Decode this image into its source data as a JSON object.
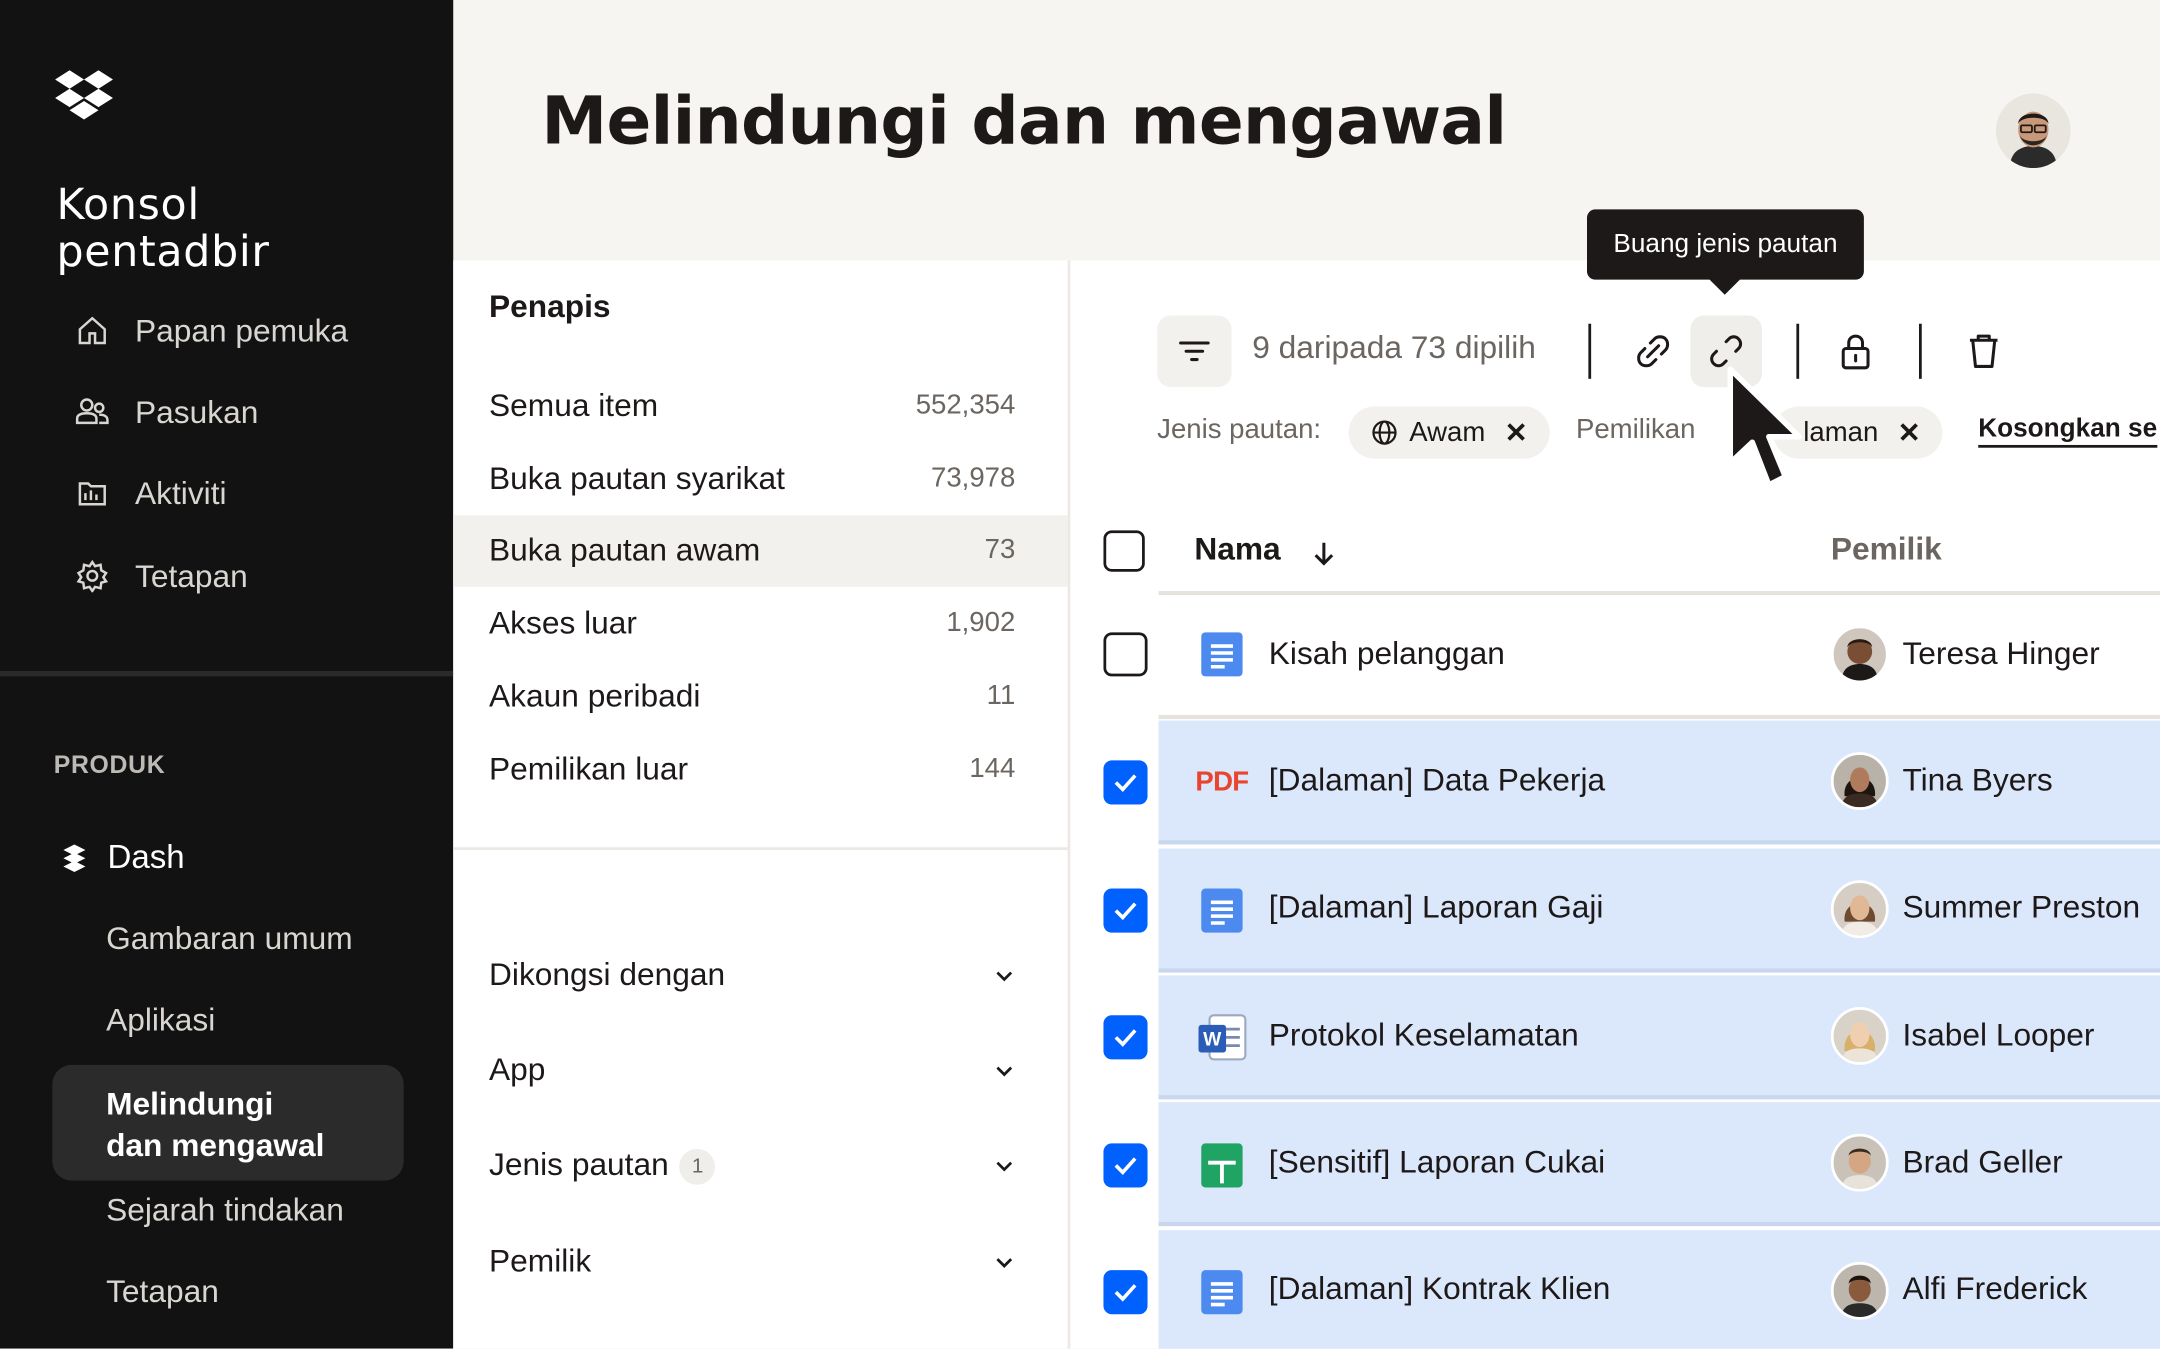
{
  "sidebar": {
    "console_title_line1": "Konsol",
    "console_title_line2": "pentadbir",
    "nav": [
      {
        "label": "Papan pemuka",
        "icon": "home-icon"
      },
      {
        "label": "Pasukan",
        "icon": "team-icon"
      },
      {
        "label": "Aktiviti",
        "icon": "activity-icon"
      },
      {
        "label": "Tetapan",
        "icon": "gear-icon"
      }
    ],
    "section_label": "PRODUK",
    "product": "Dash",
    "sub_items": [
      "Gambaran umum",
      "Aplikasi",
      "Melindungi dan mengawal",
      "Sejarah tindakan",
      "Tetapan"
    ],
    "active_sub_line1": "Melindungi",
    "active_sub_line2": "dan mengawal"
  },
  "header": {
    "title": "Melindungi dan mengawal"
  },
  "filters": {
    "title": "Penapis",
    "items": [
      {
        "label": "Semua item",
        "count": "552,354"
      },
      {
        "label": "Buka pautan syarikat",
        "count": "73,978"
      },
      {
        "label": "Buka pautan awam",
        "count": "73"
      },
      {
        "label": "Akses luar",
        "count": "1,902"
      },
      {
        "label": "Akaun peribadi",
        "count": "11"
      },
      {
        "label": "Pemilikan luar",
        "count": "144"
      }
    ],
    "accordions": [
      {
        "label": "Dikongsi dengan",
        "badge": ""
      },
      {
        "label": "App",
        "badge": ""
      },
      {
        "label": "Jenis pautan",
        "badge": "1"
      },
      {
        "label": "Pemilik",
        "badge": ""
      }
    ]
  },
  "toolbar": {
    "selection_text": "9 daripada 73 dipilih",
    "tooltip": "Buang jenis pautan",
    "chip_label": "Jenis pautan:",
    "chip_awam": "Awam",
    "chip_pemilikan": "Pemilikan",
    "chip_dalaman": "laman",
    "clear_label": "Kosongkan se"
  },
  "table": {
    "col_name": "Nama",
    "col_owner": "Pemilik",
    "rows": [
      {
        "name": "Kisah pelanggan",
        "owner": "Teresa Hinger",
        "type": "doc",
        "selected": false
      },
      {
        "name": "[Dalaman] Data Pekerja",
        "owner": "Tina Byers",
        "type": "pdf",
        "selected": true
      },
      {
        "name": "[Dalaman] Laporan Gaji",
        "owner": "Summer Preston",
        "type": "doc",
        "selected": true
      },
      {
        "name": "Protokol Keselamatan",
        "owner": "Isabel Looper",
        "type": "word",
        "selected": true
      },
      {
        "name": "[Sensitif] Laporan Cukai",
        "owner": "Brad Geller",
        "type": "sheet",
        "selected": true
      },
      {
        "name": "[Dalaman] Kontrak Klien",
        "owner": "Alfi Frederick",
        "type": "doc",
        "selected": true
      }
    ],
    "pdf_label": "PDF"
  },
  "colors": {
    "accent": "#0061fe",
    "selected_row": "#dbe8fb",
    "sidebar_bg": "#121212"
  }
}
